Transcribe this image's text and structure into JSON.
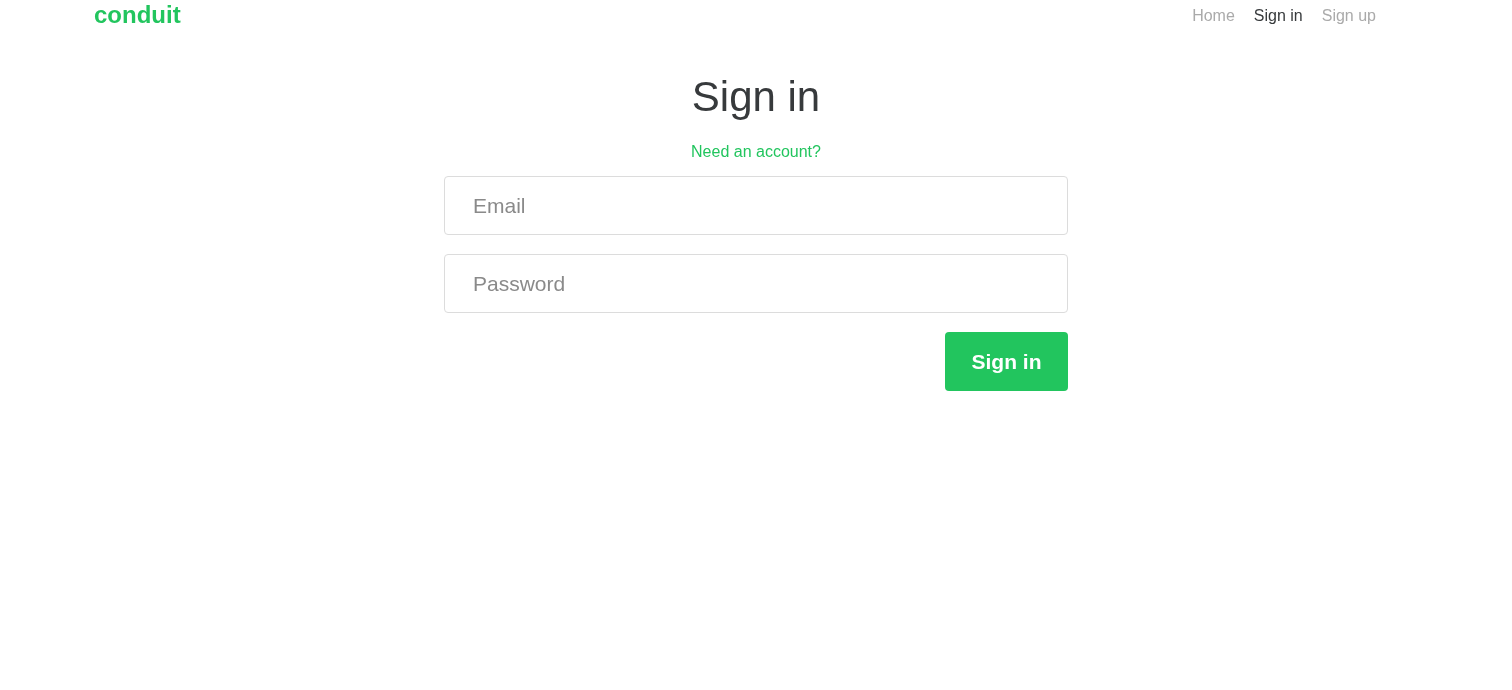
{
  "navbar": {
    "brand": "conduit",
    "links": [
      {
        "label": "Home",
        "selected": false
      },
      {
        "label": "Sign in",
        "selected": true
      },
      {
        "label": "Sign up",
        "selected": false
      }
    ]
  },
  "form": {
    "title": "Sign in",
    "switch_link": "Need an account?",
    "fields": [
      {
        "placeholder": "Email"
      },
      {
        "placeholder": "Password"
      }
    ],
    "submit": "Sign in"
  }
}
